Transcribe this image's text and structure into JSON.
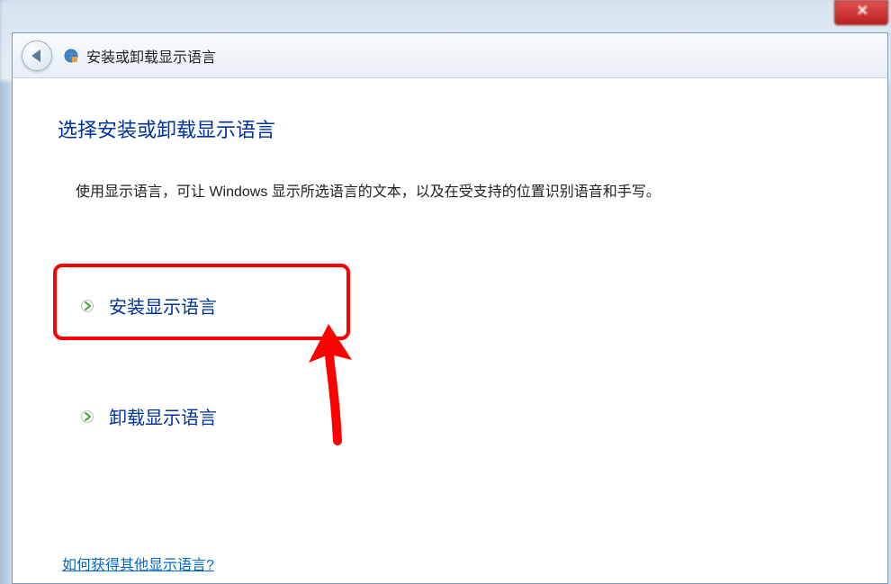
{
  "titleBar": {
    "title": "安装或卸载显示语言"
  },
  "content": {
    "heading": "选择安装或卸载显示语言",
    "description": "使用显示语言，可让 Windows 显示所选语言的文本，以及在受支持的位置识别语音和手写。",
    "options": {
      "install": "安装显示语言",
      "uninstall": "卸载显示语言"
    },
    "helpLink": "如何获得其他显示语言?"
  }
}
